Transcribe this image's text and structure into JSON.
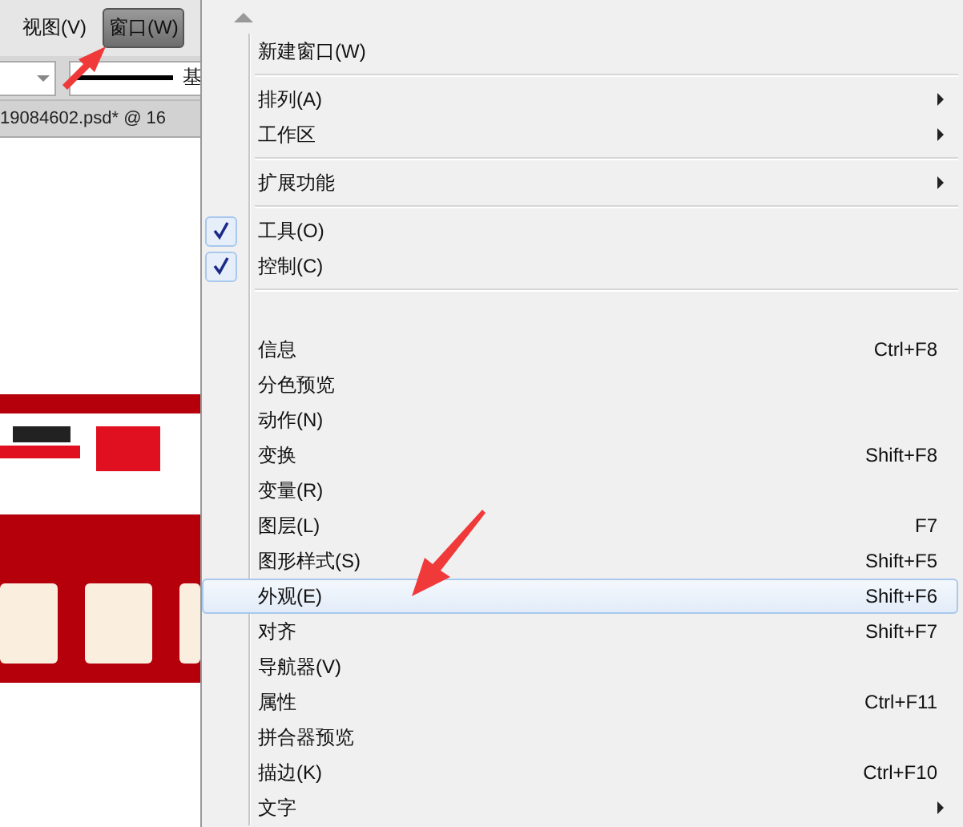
{
  "menu_bar": [
    {
      "label": "视图(V)",
      "selected": false
    },
    {
      "label": "窗口(W)",
      "selected": true
    }
  ],
  "control_bar": {
    "stroke_label": "基"
  },
  "document_tab": {
    "title": "19084602.psd* @ 16"
  },
  "window_menu": {
    "items": [
      {
        "kind": "item",
        "label": "新建窗口(W)",
        "submenu": false,
        "checked": false,
        "selected": false
      },
      {
        "kind": "separator"
      },
      {
        "kind": "item",
        "label": "排列(A)",
        "submenu": true,
        "checked": false,
        "selected": false
      },
      {
        "kind": "item",
        "label": "工作区",
        "submenu": true,
        "checked": false,
        "selected": false
      },
      {
        "kind": "separator"
      },
      {
        "kind": "item",
        "label": "扩展功能",
        "submenu": true,
        "checked": false,
        "selected": false
      },
      {
        "kind": "separator"
      },
      {
        "kind": "item",
        "label": "工具(O)",
        "submenu": false,
        "checked": true,
        "selected": false
      },
      {
        "kind": "item",
        "label": "控制(C)",
        "submenu": false,
        "checked": true,
        "selected": false
      },
      {
        "kind": "separator"
      },
      {
        "kind": "blank"
      },
      {
        "kind": "item",
        "label": "信息",
        "shortcut": "Ctrl+F8",
        "submenu": false,
        "checked": false,
        "selected": false
      },
      {
        "kind": "item",
        "label": "分色预览",
        "submenu": false,
        "checked": false,
        "selected": false
      },
      {
        "kind": "item",
        "label": "动作(N)",
        "submenu": false,
        "checked": false,
        "selected": false
      },
      {
        "kind": "item",
        "label": "变换",
        "shortcut": "Shift+F8",
        "submenu": false,
        "checked": false,
        "selected": false
      },
      {
        "kind": "item",
        "label": "变量(R)",
        "submenu": false,
        "checked": false,
        "selected": false
      },
      {
        "kind": "item",
        "label": "图层(L)",
        "shortcut": "F7",
        "submenu": false,
        "checked": false,
        "selected": false
      },
      {
        "kind": "item",
        "label": "图形样式(S)",
        "shortcut": "Shift+F5",
        "submenu": false,
        "checked": false,
        "selected": false
      },
      {
        "kind": "item",
        "label": "外观(E)",
        "shortcut": "Shift+F6",
        "submenu": false,
        "checked": false,
        "selected": true
      },
      {
        "kind": "item",
        "label": "对齐",
        "shortcut": "Shift+F7",
        "submenu": false,
        "checked": false,
        "selected": false
      },
      {
        "kind": "item",
        "label": "导航器(V)",
        "submenu": false,
        "checked": false,
        "selected": false
      },
      {
        "kind": "item",
        "label": "属性",
        "shortcut": "Ctrl+F11",
        "submenu": false,
        "checked": false,
        "selected": false
      },
      {
        "kind": "item",
        "label": "拼合器预览",
        "submenu": false,
        "checked": false,
        "selected": false
      },
      {
        "kind": "item",
        "label": "描边(K)",
        "shortcut": "Ctrl+F10",
        "submenu": false,
        "checked": false,
        "selected": false
      },
      {
        "kind": "item",
        "label": "文字",
        "submenu": true,
        "checked": false,
        "selected": false
      }
    ]
  }
}
